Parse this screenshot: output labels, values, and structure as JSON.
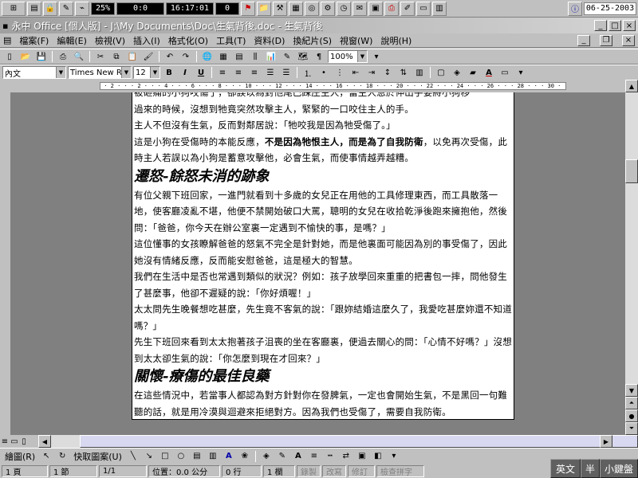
{
  "taskbar": {
    "battery": "25%",
    "counter": "0:0",
    "clock": "16:17:01",
    "number": "0",
    "date": "06-25-2003"
  },
  "window": {
    "title": "永中 Office [個人版] - J:\\My Documents\\Doc\\生氣背後.doc - 生氣背後"
  },
  "menu": [
    "檔案(F)",
    "編輯(E)",
    "檢視(V)",
    "插入(I)",
    "格式化(O)",
    "工具(T)",
    "資料(D)",
    "換紀片(S)",
    "視窗(W)",
    "說明(H)"
  ],
  "toolbar": {
    "zoom": "100%",
    "style": "內文",
    "font": "Times New Roi",
    "size": "12"
  },
  "document": {
    "line0": "被砸痛的小狗咬傷了，卻誤以為對他尾巴踩庄主人，當主人急於伸出手要將小狗移",
    "line1": "過來的時候，沒想到牠竟突然攻擊主人，緊緊的一口咬住主人的手。",
    "line2": "主人不但沒有生氣，反而對鄰居說：「牠咬我是因為牠受傷了。」",
    "p1_a": "這是小狗在受傷時的本能反應，",
    "p1_b": "不是因為牠恨主人，而是為了自我防衛",
    "p1_c": "，以免再次受傷，此時主人若誤以為小狗是蓄意攻擊他，必會生氣，而使事情越弄越糟。",
    "heading1": "遷怒-餘怒未消的跡象",
    "p2": "有位父親下班回家，一進門就看到十多歲的女兒正在用他的工具修理東西，而工具散落一地，使客廳凌亂不堪，他便不禁開始破口大罵，聰明的女兒在收拾乾淨後跑來擁抱他，然後問：「爸爸，你今天在辦公室裏一定遇到不愉快的事，是嗎？」",
    "p3": "這位懂事的女孩瞭解爸爸的怒氣不完全是針對她，而是他裏面可能因為別的事受傷了，因此她沒有情緒反應，反而能安慰爸爸，這是極大的智慧。",
    "p4": "我們在生活中是否也常遇到類似的狀況？例如：孩子放學回來重重的把書包一摔，問他發生了甚麼事，他卻不遲疑的說：「你好煩喔！」",
    "p5": "太太問先生晚餐想吃甚麼，先生竟不客氣的說：「跟妳結婚這麼久了，我愛吃甚麼妳還不知道嗎？」",
    "p6": "先生下班回來看到太太抱著孩子沮喪的坐在客廳裏，便過去關心的問：「心情不好嗎？」沒想到太太卻生氣的說：「你怎麼到現在才回來？」",
    "heading2": "關懷-療傷的最佳良藥",
    "p7": "在這些情況中，若當事人都認為對方針對你在發脾氣，一定也會開始生氣，不是黑回一句難聽的話，就是用冷漠與迴避來拒絕對方。因為我們也受傷了，需要自我防衛。"
  },
  "drawbar": {
    "draw": "繪圖(R)",
    "autoshapes": "快取圖案(U)"
  },
  "status": {
    "page": "1 頁",
    "section": "1 節",
    "pages": "1/1",
    "position": "位置：0.0 公分",
    "line": "0 行",
    "col": "1 欄",
    "rec": "錄製",
    "rev": "改寫",
    "ext": "修訂",
    "spell": "檢查拼字"
  },
  "ime": {
    "lang": "英文",
    "width": "半",
    "mode": "小鍵盤"
  }
}
